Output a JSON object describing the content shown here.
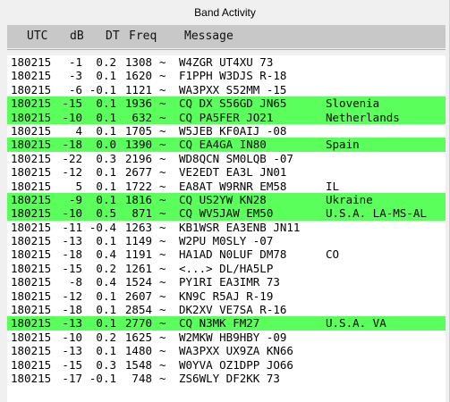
{
  "window": {
    "title": "Band Activity"
  },
  "columns": {
    "utc": "UTC",
    "db": "dB",
    "dt": "DT",
    "freq": "Freq",
    "message": "Message"
  },
  "colors": {
    "highlight": "#5bff5b",
    "header_bg": "#c8c8c8",
    "list_bg": "#ffffff"
  },
  "rows": [
    {
      "utc": "180215",
      "db": "-1",
      "dt": "0.2",
      "freq": "1308",
      "sep": "~",
      "message": "W4ZGR UT4XU 73",
      "country": "",
      "highlight": false
    },
    {
      "utc": "180215",
      "db": "-3",
      "dt": "0.1",
      "freq": "1620",
      "sep": "~",
      "message": "F1PPH W3DJS R-18",
      "country": "",
      "highlight": false
    },
    {
      "utc": "180215",
      "db": "-6",
      "dt": "-0.1",
      "freq": "1121",
      "sep": "~",
      "message": "WA3PXX S52MM -15",
      "country": "",
      "highlight": false
    },
    {
      "utc": "180215",
      "db": "-15",
      "dt": "0.1",
      "freq": "1936",
      "sep": "~",
      "message": "CQ DX S56GD JN65",
      "country": "Slovenia",
      "highlight": true
    },
    {
      "utc": "180215",
      "db": "-10",
      "dt": "0.1",
      "freq": "632",
      "sep": "~",
      "message": "CQ PA5FER JO21",
      "country": "Netherlands",
      "highlight": true
    },
    {
      "utc": "180215",
      "db": "4",
      "dt": "0.1",
      "freq": "1705",
      "sep": "~",
      "message": "W5JEB KF0AIJ -08",
      "country": "",
      "highlight": false
    },
    {
      "utc": "180215",
      "db": "-18",
      "dt": "0.0",
      "freq": "1390",
      "sep": "~",
      "message": "CQ EA4GA IN80",
      "country": "Spain",
      "highlight": true
    },
    {
      "utc": "180215",
      "db": "-22",
      "dt": "0.3",
      "freq": "2196",
      "sep": "~",
      "message": "WD8QCN SM0LQB -07",
      "country": "",
      "highlight": false
    },
    {
      "utc": "180215",
      "db": "-12",
      "dt": "0.1",
      "freq": "2677",
      "sep": "~",
      "message": "VE2EDT EA3L JN01",
      "country": "",
      "highlight": false
    },
    {
      "utc": "180215",
      "db": "5",
      "dt": "0.1",
      "freq": "1722",
      "sep": "~",
      "message": "EA8AT W9RNR EM58",
      "country": "IL",
      "highlight": false
    },
    {
      "utc": "180215",
      "db": "-9",
      "dt": "0.1",
      "freq": "1816",
      "sep": "~",
      "message": "CQ US2YW KN28",
      "country": "Ukraine",
      "highlight": true
    },
    {
      "utc": "180215",
      "db": "-10",
      "dt": "0.5",
      "freq": "871",
      "sep": "~",
      "message": "CQ WV5JAW EM50",
      "country": "U.S.A. LA-MS-AL",
      "highlight": true
    },
    {
      "utc": "180215",
      "db": "-11",
      "dt": "-0.4",
      "freq": "1263",
      "sep": "~",
      "message": "KB1WSR EA3ENB JN11",
      "country": "",
      "highlight": false
    },
    {
      "utc": "180215",
      "db": "-13",
      "dt": "0.1",
      "freq": "1149",
      "sep": "~",
      "message": "W2PU M0SLY -07",
      "country": "",
      "highlight": false
    },
    {
      "utc": "180215",
      "db": "-18",
      "dt": "0.4",
      "freq": "1191",
      "sep": "~",
      "message": "HA1AD N0LUF DM78",
      "country": "CO",
      "highlight": false
    },
    {
      "utc": "180215",
      "db": "-15",
      "dt": "0.2",
      "freq": "1261",
      "sep": "~",
      "message": "<...> DL/HA5LP",
      "country": "",
      "highlight": false
    },
    {
      "utc": "180215",
      "db": "-8",
      "dt": "0.4",
      "freq": "1524",
      "sep": "~",
      "message": "PY1RI EA3IMR 73",
      "country": "",
      "highlight": false
    },
    {
      "utc": "180215",
      "db": "-12",
      "dt": "0.1",
      "freq": "2607",
      "sep": "~",
      "message": "KN9C R5AJ R-19",
      "country": "",
      "highlight": false
    },
    {
      "utc": "180215",
      "db": "-18",
      "dt": "0.1",
      "freq": "2854",
      "sep": "~",
      "message": "DK2XV VE7SA R-16",
      "country": "",
      "highlight": false
    },
    {
      "utc": "180215",
      "db": "-13",
      "dt": "0.1",
      "freq": "2770",
      "sep": "~",
      "message": "CQ N3MK FM27",
      "country": "U.S.A. VA",
      "highlight": true
    },
    {
      "utc": "180215",
      "db": "-10",
      "dt": "0.2",
      "freq": "1625",
      "sep": "~",
      "message": "W2MKW HB9HBY -09",
      "country": "",
      "highlight": false
    },
    {
      "utc": "180215",
      "db": "-13",
      "dt": "0.1",
      "freq": "1480",
      "sep": "~",
      "message": "WA3PXX UX9ZA KN66",
      "country": "",
      "highlight": false
    },
    {
      "utc": "180215",
      "db": "-15",
      "dt": "0.3",
      "freq": "1548",
      "sep": "~",
      "message": "W0YVA OZ1DPP JO66",
      "country": "",
      "highlight": false
    },
    {
      "utc": "180215",
      "db": "-17",
      "dt": "-0.1",
      "freq": "748",
      "sep": "~",
      "message": "ZS6WLY DF2KK 73",
      "country": "",
      "highlight": false
    }
  ]
}
